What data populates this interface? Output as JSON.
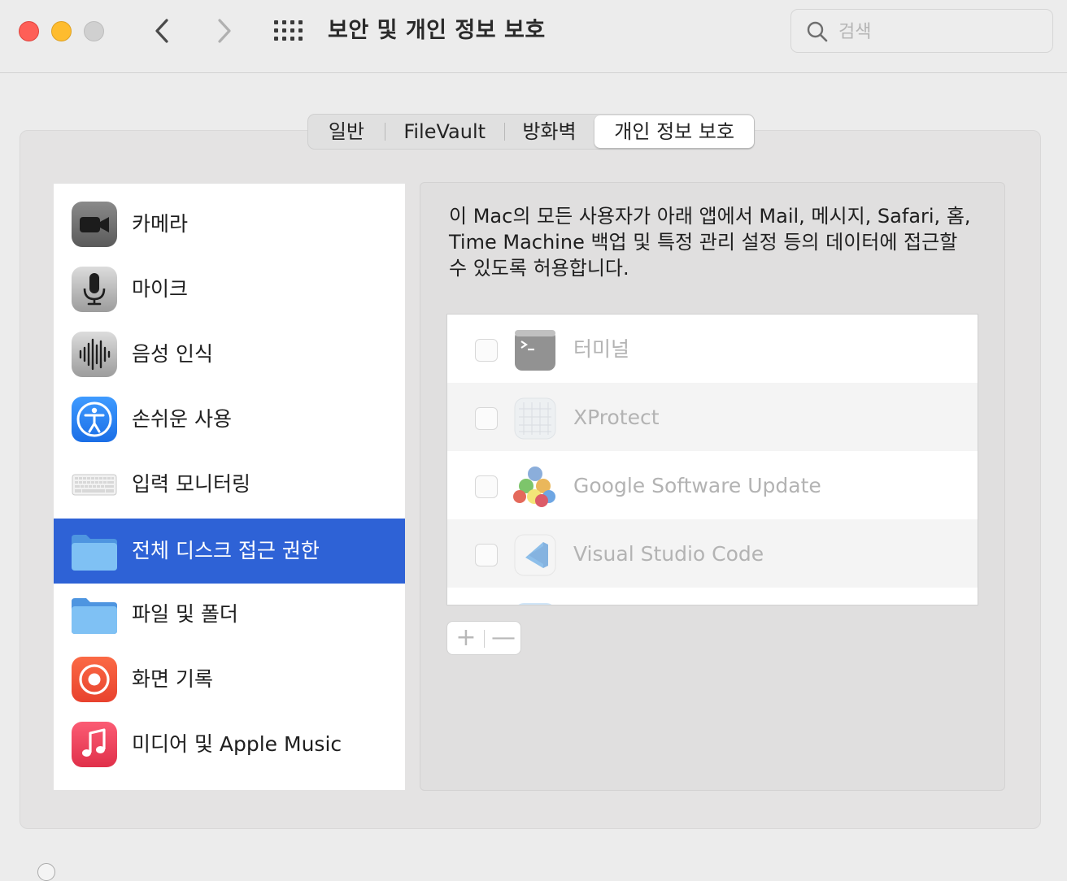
{
  "window": {
    "title": "보안 및 개인 정보 보호"
  },
  "search": {
    "placeholder": "검색"
  },
  "tabs": [
    {
      "label": "일반"
    },
    {
      "label": "FileVault"
    },
    {
      "label": "방화벽"
    },
    {
      "label": "개인 정보 보호",
      "selected": true
    }
  ],
  "sidebar": {
    "items": [
      {
        "label": "카메라",
        "icon": "camera-icon"
      },
      {
        "label": "마이크",
        "icon": "microphone-icon"
      },
      {
        "label": "음성 인식",
        "icon": "waveform-icon"
      },
      {
        "label": "손쉬운 사용",
        "icon": "accessibility-icon"
      },
      {
        "label": "입력 모니터링",
        "icon": "keyboard-icon"
      },
      {
        "label": "전체 디스크 접근 권한",
        "icon": "folder-icon",
        "selected": true
      },
      {
        "label": "파일 및 폴더",
        "icon": "folder-icon"
      },
      {
        "label": "화면 기록",
        "icon": "screen-record-icon"
      },
      {
        "label": "미디어 및 Apple Music",
        "icon": "music-icon"
      }
    ]
  },
  "detail": {
    "description_lines": [
      "이 Mac의 모든 사용자가 아래 앱에서 Mail, 메시지, Safari, 홈,",
      "Time Machine 백업 및 특정 관리 설정 등의 데이터에 접근할",
      "수 있도록 허용합니다."
    ],
    "apps": [
      {
        "name": "터미널",
        "icon": "terminal-icon",
        "checked": false
      },
      {
        "name": "XProtect",
        "icon": "xprotect-icon",
        "checked": false
      },
      {
        "name": "Google Software Update",
        "icon": "google-update-icon",
        "checked": false
      },
      {
        "name": "Visual Studio Code",
        "icon": "vscode-icon",
        "checked": false
      }
    ],
    "add_label": "+",
    "remove_label": "—"
  },
  "colors": {
    "selection": "#2e62d6",
    "window_bg": "#ececec",
    "close": "#fe5f57",
    "minimize": "#febc2e"
  }
}
